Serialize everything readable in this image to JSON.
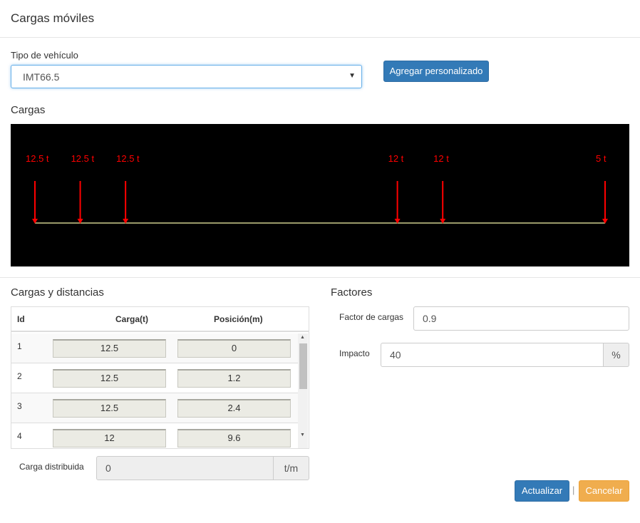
{
  "header": {
    "title": "Cargas móviles"
  },
  "vehicle": {
    "label": "Tipo de vehículo",
    "selected": "IMT66.5",
    "add_custom_label": "Agregar personalizado"
  },
  "loads_section": {
    "title": "Cargas"
  },
  "diagram": {
    "loads": [
      {
        "label": "12.5 t",
        "position": 0
      },
      {
        "label": "12.5 t",
        "position": 1.2
      },
      {
        "label": "12.5 t",
        "position": 2.4
      },
      {
        "label": "12 t",
        "position": 9.6
      },
      {
        "label": "12 t",
        "position": 10.8
      },
      {
        "label": "5 t",
        "position": 15.1
      }
    ],
    "arrow_color": "#ff0000",
    "beam_color": "#9a9a6a",
    "background": "#000000"
  },
  "table_section": {
    "title": "Cargas y distancias",
    "columns": {
      "id": "Id",
      "load": "Carga(t)",
      "position": "Posición(m)"
    },
    "rows": [
      {
        "id": "1",
        "load": "12.5",
        "position": "0"
      },
      {
        "id": "2",
        "load": "12.5",
        "position": "1.2"
      },
      {
        "id": "3",
        "load": "12.5",
        "position": "2.4"
      },
      {
        "id": "4",
        "load": "12",
        "position": "9.6"
      }
    ]
  },
  "distributed": {
    "label": "Carga distribuida",
    "value": "0",
    "unit": "t/m"
  },
  "factors": {
    "title": "Factores",
    "load_factor_label": "Factor de cargas",
    "load_factor_value": "0.9",
    "impact_label": "Impacto",
    "impact_value": "40",
    "impact_unit": "%"
  },
  "actions": {
    "update_label": "Actualizar",
    "separator": "|",
    "cancel_label": "Cancelar"
  },
  "colors": {
    "primary": "#337ab7",
    "warning": "#f0ad4e"
  }
}
